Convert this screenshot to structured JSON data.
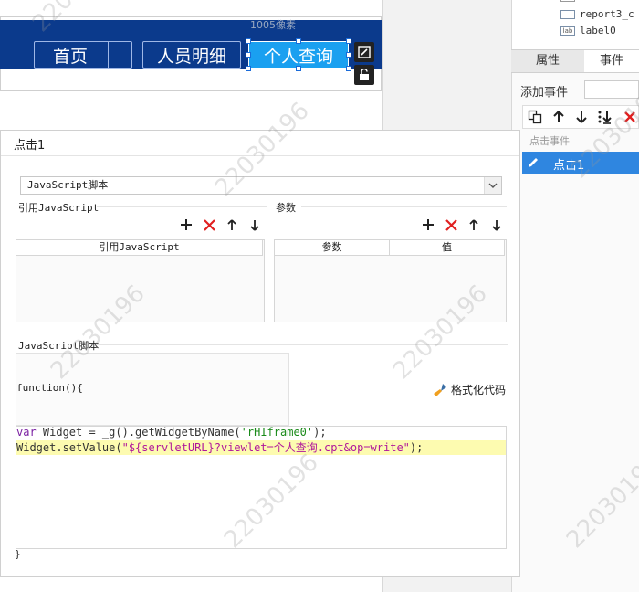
{
  "canvas": {
    "size_label": "1005像素",
    "nav_buttons": [
      {
        "label": "首页"
      },
      {
        "label": "人员明细"
      },
      {
        "label": "个人查询"
      }
    ]
  },
  "right_panel": {
    "tree_items": [
      {
        "icon": "textbox-icon",
        "label": "report3_c"
      },
      {
        "icon": "label-icon",
        "icon_text": "lab",
        "label": "label0"
      }
    ],
    "tabs": [
      "属性",
      "事件"
    ],
    "add_event_label": "添加事件",
    "section_label": "点击事件",
    "events": [
      {
        "label": "点击1"
      }
    ]
  },
  "dialog": {
    "title": "点击1",
    "script_type": "JavaScript脚本",
    "ref_js_section": "引用JavaScript",
    "params_section": "参数",
    "ref_js_table_header": "引用JavaScript",
    "params_table_headers": [
      "参数",
      "值"
    ],
    "script_section": "JavaScript脚本",
    "function_open": "function(){",
    "format_button": "格式化代码",
    "code_lines": [
      {
        "kw": "var",
        "rest": " Widget = _g().getWidgetByName(",
        "str": "'rHIframe0'",
        "tail": ");"
      },
      {
        "prefix": "Widget.setValue(",
        "str": "\"${servletURL}?viewlet=个人查询.cpt&op=write\"",
        "tail": ");"
      }
    ],
    "function_close": "}"
  },
  "watermark": "22030196",
  "colors": {
    "banner": "#0b3a8c",
    "active_nav": "#1aa0f0",
    "selected_event": "#2f86e0",
    "delete_red": "#e02020",
    "code_highlight": "#fdfbb0"
  }
}
